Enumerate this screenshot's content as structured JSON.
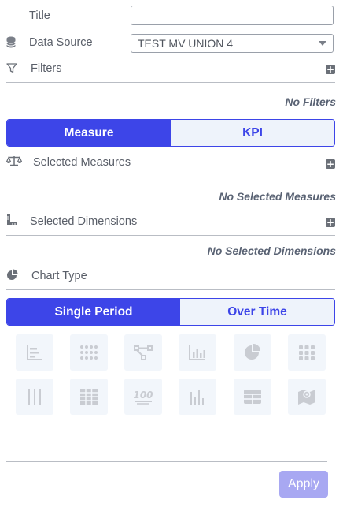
{
  "form": {
    "title_label": "Title",
    "title_value": "",
    "datasource_label": "Data Source",
    "datasource_value": "TEST MV UNION 4",
    "filters_label": "Filters",
    "filters_empty": "No Filters"
  },
  "mode_toggle": {
    "measure_label": "Measure",
    "kpi_label": "KPI",
    "selected": "Measure"
  },
  "measures": {
    "label": "Selected Measures",
    "empty": "No Selected Measures"
  },
  "dimensions": {
    "label": "Selected Dimensions",
    "empty": "No Selected Dimensions"
  },
  "chart_type": {
    "label": "Chart Type",
    "period_single_label": "Single Period",
    "period_overtime_label": "Over Time",
    "selected_period": "Single Period",
    "icons": [
      "bar-chart-horizontal-icon",
      "dot-grid-icon",
      "tree-diagram-icon",
      "column-chart-icon",
      "pie-chart-icon",
      "dot-matrix-icon",
      "vertical-lines-icon",
      "table-grid-icon",
      "hundred-kpi-icon",
      "thin-bars-icon",
      "layout-table-icon",
      "map-icon"
    ]
  },
  "footer": {
    "apply_label": "Apply"
  },
  "colors": {
    "accent": "#3d45e8",
    "accent_light": "#eef3fb",
    "apply_disabled": "#a8a8f2"
  }
}
